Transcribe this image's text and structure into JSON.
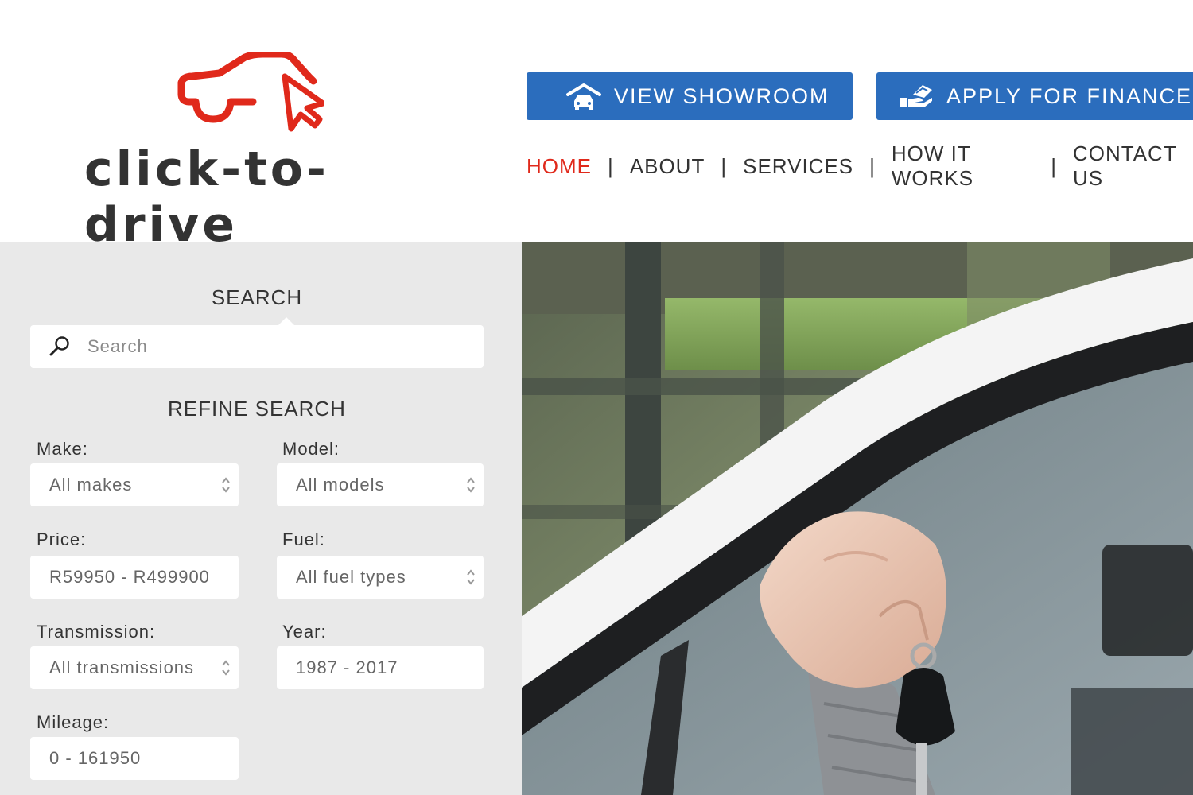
{
  "brand": {
    "name": "click-to-drive",
    "logo_color": "#e0291b"
  },
  "header": {
    "buttons": [
      {
        "label": "VIEW SHOWROOM",
        "icon": "showroom-icon"
      },
      {
        "label": "APPLY FOR FINANCE",
        "icon": "finance-icon"
      }
    ],
    "nav": [
      {
        "label": "HOME",
        "active": true
      },
      {
        "label": "ABOUT"
      },
      {
        "label": "SERVICES"
      },
      {
        "label": "HOW IT WORKS"
      },
      {
        "label": "CONTACT US"
      }
    ],
    "nav_separator": "|"
  },
  "search": {
    "title": "SEARCH",
    "placeholder": "Search",
    "icon": "search-icon"
  },
  "refine": {
    "title": "REFINE SEARCH",
    "make": {
      "label": "Make:",
      "value": "All makes"
    },
    "model": {
      "label": "Model:",
      "value": "All models"
    },
    "price": {
      "label": "Price:",
      "value": "R59950 - R499900"
    },
    "fuel": {
      "label": "Fuel:",
      "value": "All fuel types"
    },
    "transmission": {
      "label": "Transmission:",
      "value": "All transmissions"
    },
    "year": {
      "label": "Year:",
      "value": "1987 - 2017"
    },
    "mileage": {
      "label": "Mileage:",
      "value": "0 - 161950"
    }
  },
  "colors": {
    "accent_blue": "#2b6dbd",
    "accent_red": "#e0291b",
    "panel_bg": "#e9e9e9"
  }
}
